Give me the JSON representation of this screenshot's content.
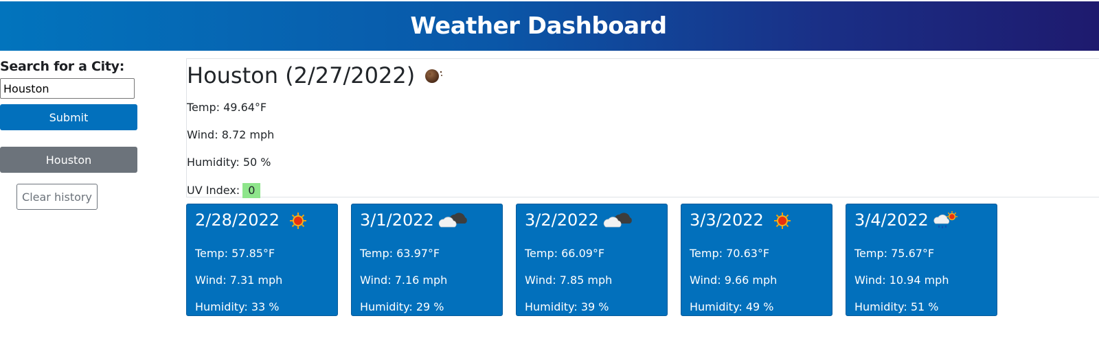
{
  "header": {
    "title": "Weather Dashboard"
  },
  "search": {
    "label": "Search for a City:",
    "input_value": "Houston",
    "submit_label": "Submit",
    "history": [
      "Houston"
    ],
    "clear_label": "Clear history"
  },
  "current": {
    "title": "Houston (2/27/2022)",
    "icon": "moon-night-icon",
    "temp": "Temp: 49.64°F",
    "wind": "Wind: 8.72 mph",
    "humidity": "Humidity: 50 %",
    "uv_label": "UV Index:",
    "uv_value": "0",
    "uv_color": "#8ee58b"
  },
  "forecast": [
    {
      "date": "2/28/2022",
      "icon": "sun-icon",
      "temp": "Temp: 57.85°F",
      "wind": "Wind: 7.31 mph",
      "humidity": "Humidity: 33 %"
    },
    {
      "date": "3/1/2022",
      "icon": "cloudy-icon",
      "temp": "Temp: 63.97°F",
      "wind": "Wind: 7.16 mph",
      "humidity": "Humidity: 29 %"
    },
    {
      "date": "3/2/2022",
      "icon": "cloudy-icon",
      "temp": "Temp: 66.09°F",
      "wind": "Wind: 7.85 mph",
      "humidity": "Humidity: 39 %"
    },
    {
      "date": "3/3/2022",
      "icon": "sun-icon",
      "temp": "Temp: 70.63°F",
      "wind": "Wind: 9.66 mph",
      "humidity": "Humidity: 49 %"
    },
    {
      "date": "3/4/2022",
      "icon": "rain-sun-icon",
      "temp": "Temp: 75.67°F",
      "wind": "Wind: 10.94 mph",
      "humidity": "Humidity: 51 %"
    }
  ],
  "colors": {
    "primary": "#0270bc",
    "secondary": "#6c737b",
    "header_start": "#0274bd",
    "header_end": "#1e1a6e"
  }
}
